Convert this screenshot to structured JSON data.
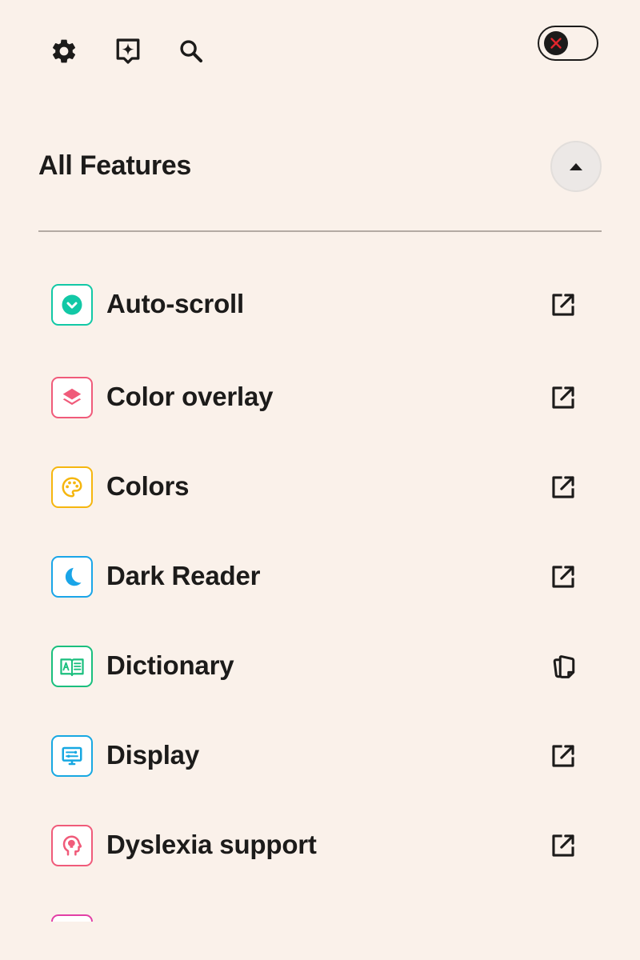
{
  "toolbar": {
    "settings_icon": "gear-icon",
    "ai_icon": "sparkle-bookmark-icon",
    "search_icon": "search-icon",
    "toggle_state": "off",
    "toggle_icon": "close-x-icon",
    "toggle_icon_color": "#E1262D"
  },
  "section": {
    "title": "All Features",
    "collapse_icon": "caret-up-icon"
  },
  "features": [
    {
      "label": "Auto-scroll",
      "icon": "chevron-down-circle-icon",
      "color": "#12C8A6",
      "action": "open-external-icon"
    },
    {
      "label": "Color overlay",
      "icon": "layers-icon",
      "color": "#F05B7A",
      "action": "open-external-icon"
    },
    {
      "label": "Colors",
      "icon": "palette-icon",
      "color": "#F5B60F",
      "action": "open-external-icon"
    },
    {
      "label": "Dark Reader",
      "icon": "moon-icon",
      "color": "#1AA5E8",
      "action": "open-external-icon"
    },
    {
      "label": "Dictionary",
      "icon": "dictionary-book-icon",
      "color": "#1ABF7E",
      "action": "copy-icon"
    },
    {
      "label": "Display",
      "icon": "monitor-settings-icon",
      "color": "#17A8E2",
      "action": "open-external-icon"
    },
    {
      "label": "Dyslexia support",
      "icon": "head-brain-icon",
      "color": "#F05B7A",
      "action": "open-external-icon"
    },
    {
      "label": "",
      "icon": "feature-icon",
      "color": "#E23FA6",
      "action": ""
    }
  ]
}
